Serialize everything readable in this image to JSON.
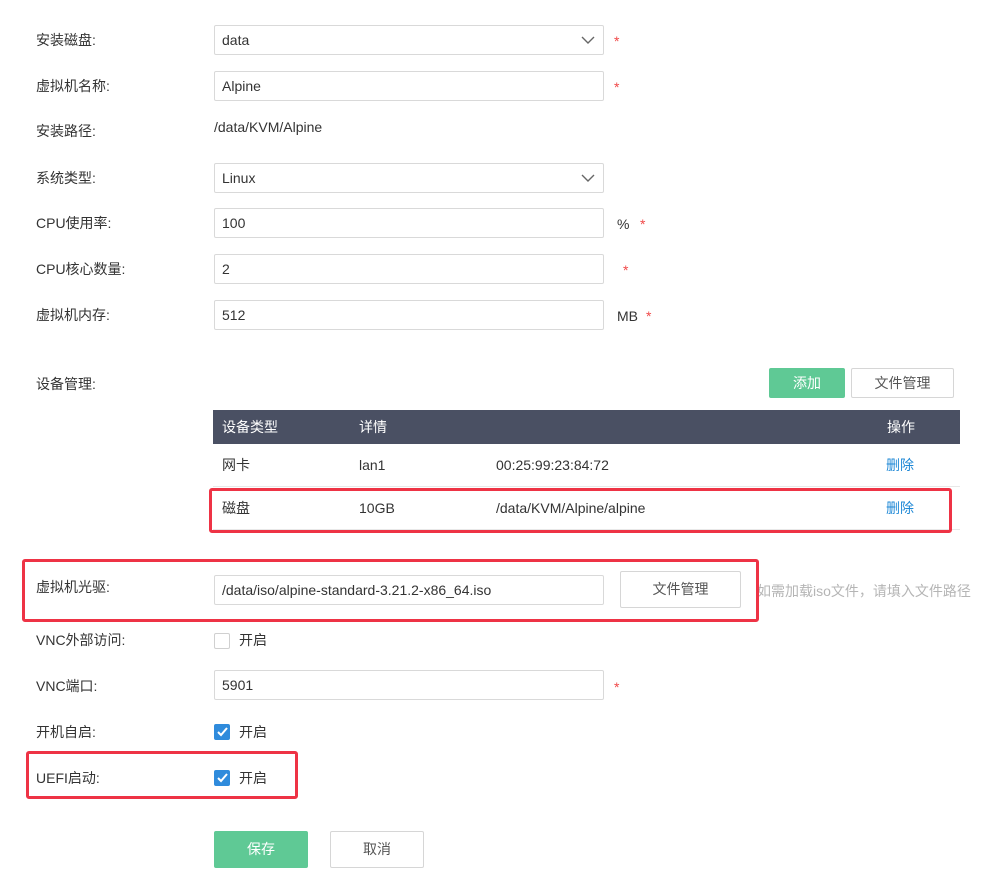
{
  "form": {
    "disk": {
      "label": "安装磁盘:",
      "value": "data",
      "required": "*"
    },
    "vm_name": {
      "label": "虚拟机名称:",
      "value": "Alpine",
      "required": "*"
    },
    "install_path": {
      "label": "安装路径:",
      "value": "/data/KVM/Alpine"
    },
    "os_type": {
      "label": "系统类型:",
      "value": "Linux"
    },
    "cpu_usage": {
      "label": "CPU使用率:",
      "value": "100",
      "unit": "%",
      "required": "*"
    },
    "cpu_cores": {
      "label": "CPU核心数量:",
      "value": "2",
      "required": "*"
    },
    "memory": {
      "label": "虚拟机内存:",
      "value": "512",
      "unit": "MB",
      "required": "*"
    },
    "devices": {
      "label": "设备管理:",
      "add_button": "添加",
      "file_manager_button": "文件管理",
      "columns": {
        "type": "设备类型",
        "detail": "详情",
        "action": "操作"
      },
      "rows": [
        {
          "type": "网卡",
          "detail1": "lan1",
          "detail2": "00:25:99:23:84:72",
          "action": "删除"
        },
        {
          "type": "磁盘",
          "detail1": "10GB",
          "detail2": "/data/KVM/Alpine/alpine",
          "action": "删除"
        }
      ]
    },
    "cdrom": {
      "label": "虚拟机光驱:",
      "value": "/data/iso/alpine-standard-3.21.2-x86_64.iso",
      "button": "文件管理",
      "hint": "如需加载iso文件，请填入文件路径"
    },
    "vnc_external": {
      "label": "VNC外部访问:",
      "option": "开启",
      "checked": false
    },
    "vnc_port": {
      "label": "VNC端口:",
      "value": "5901",
      "required": "*"
    },
    "autostart": {
      "label": "开机自启:",
      "option": "开启",
      "checked": true
    },
    "uefi": {
      "label": "UEFI启动:",
      "option": "开启",
      "checked": true
    },
    "save_button": "保存",
    "cancel_button": "取消"
  },
  "colors": {
    "primary_green": "#5fc995",
    "table_header": "#4a5063",
    "link_blue": "#1e88d6",
    "required_red": "#f04848",
    "highlight_red": "#ee3345",
    "checkbox_blue": "#2f8bdc"
  }
}
